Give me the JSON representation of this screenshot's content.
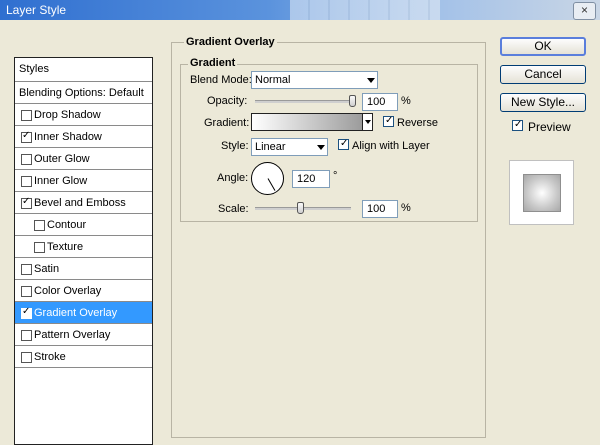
{
  "window": {
    "title": "Layer Style",
    "close_glyph": "×"
  },
  "left_panel": {
    "header": "Styles",
    "blending": "Blending Options: Default",
    "items": [
      {
        "label": "Drop Shadow",
        "checked": false
      },
      {
        "label": "Inner Shadow",
        "checked": true
      },
      {
        "label": "Outer Glow",
        "checked": false
      },
      {
        "label": "Inner Glow",
        "checked": false
      },
      {
        "label": "Bevel and Emboss",
        "checked": true
      },
      {
        "label": "Contour",
        "checked": false
      },
      {
        "label": "Texture",
        "checked": false
      },
      {
        "label": "Satin",
        "checked": false
      },
      {
        "label": "Color Overlay",
        "checked": false
      },
      {
        "label": "Gradient Overlay",
        "checked": true,
        "selected": true
      },
      {
        "label": "Pattern Overlay",
        "checked": false
      },
      {
        "label": "Stroke",
        "checked": false
      }
    ]
  },
  "panel": {
    "title": "Gradient Overlay",
    "group_title": "Gradient",
    "blend_mode": {
      "label": "Blend Mode:",
      "value": "Normal"
    },
    "opacity": {
      "label": "Opacity:",
      "value": "100",
      "unit": "%",
      "percent": 100
    },
    "gradient": {
      "label": "Gradient:",
      "reverse_label": "Reverse",
      "reverse_checked": true
    },
    "style": {
      "label": "Style:",
      "value": "Linear",
      "align_label": "Align with Layer",
      "align_checked": true
    },
    "angle": {
      "label": "Angle:",
      "value": "120",
      "unit": "°"
    },
    "scale": {
      "label": "Scale:",
      "value": "100",
      "unit": "%",
      "percent": 100
    }
  },
  "buttons": {
    "ok": "OK",
    "cancel": "Cancel",
    "new_style": "New Style..."
  },
  "preview": {
    "label": "Preview",
    "checked": true
  },
  "colors": {
    "selection": "#3399ff",
    "title_bar": "#2f6fd0"
  }
}
